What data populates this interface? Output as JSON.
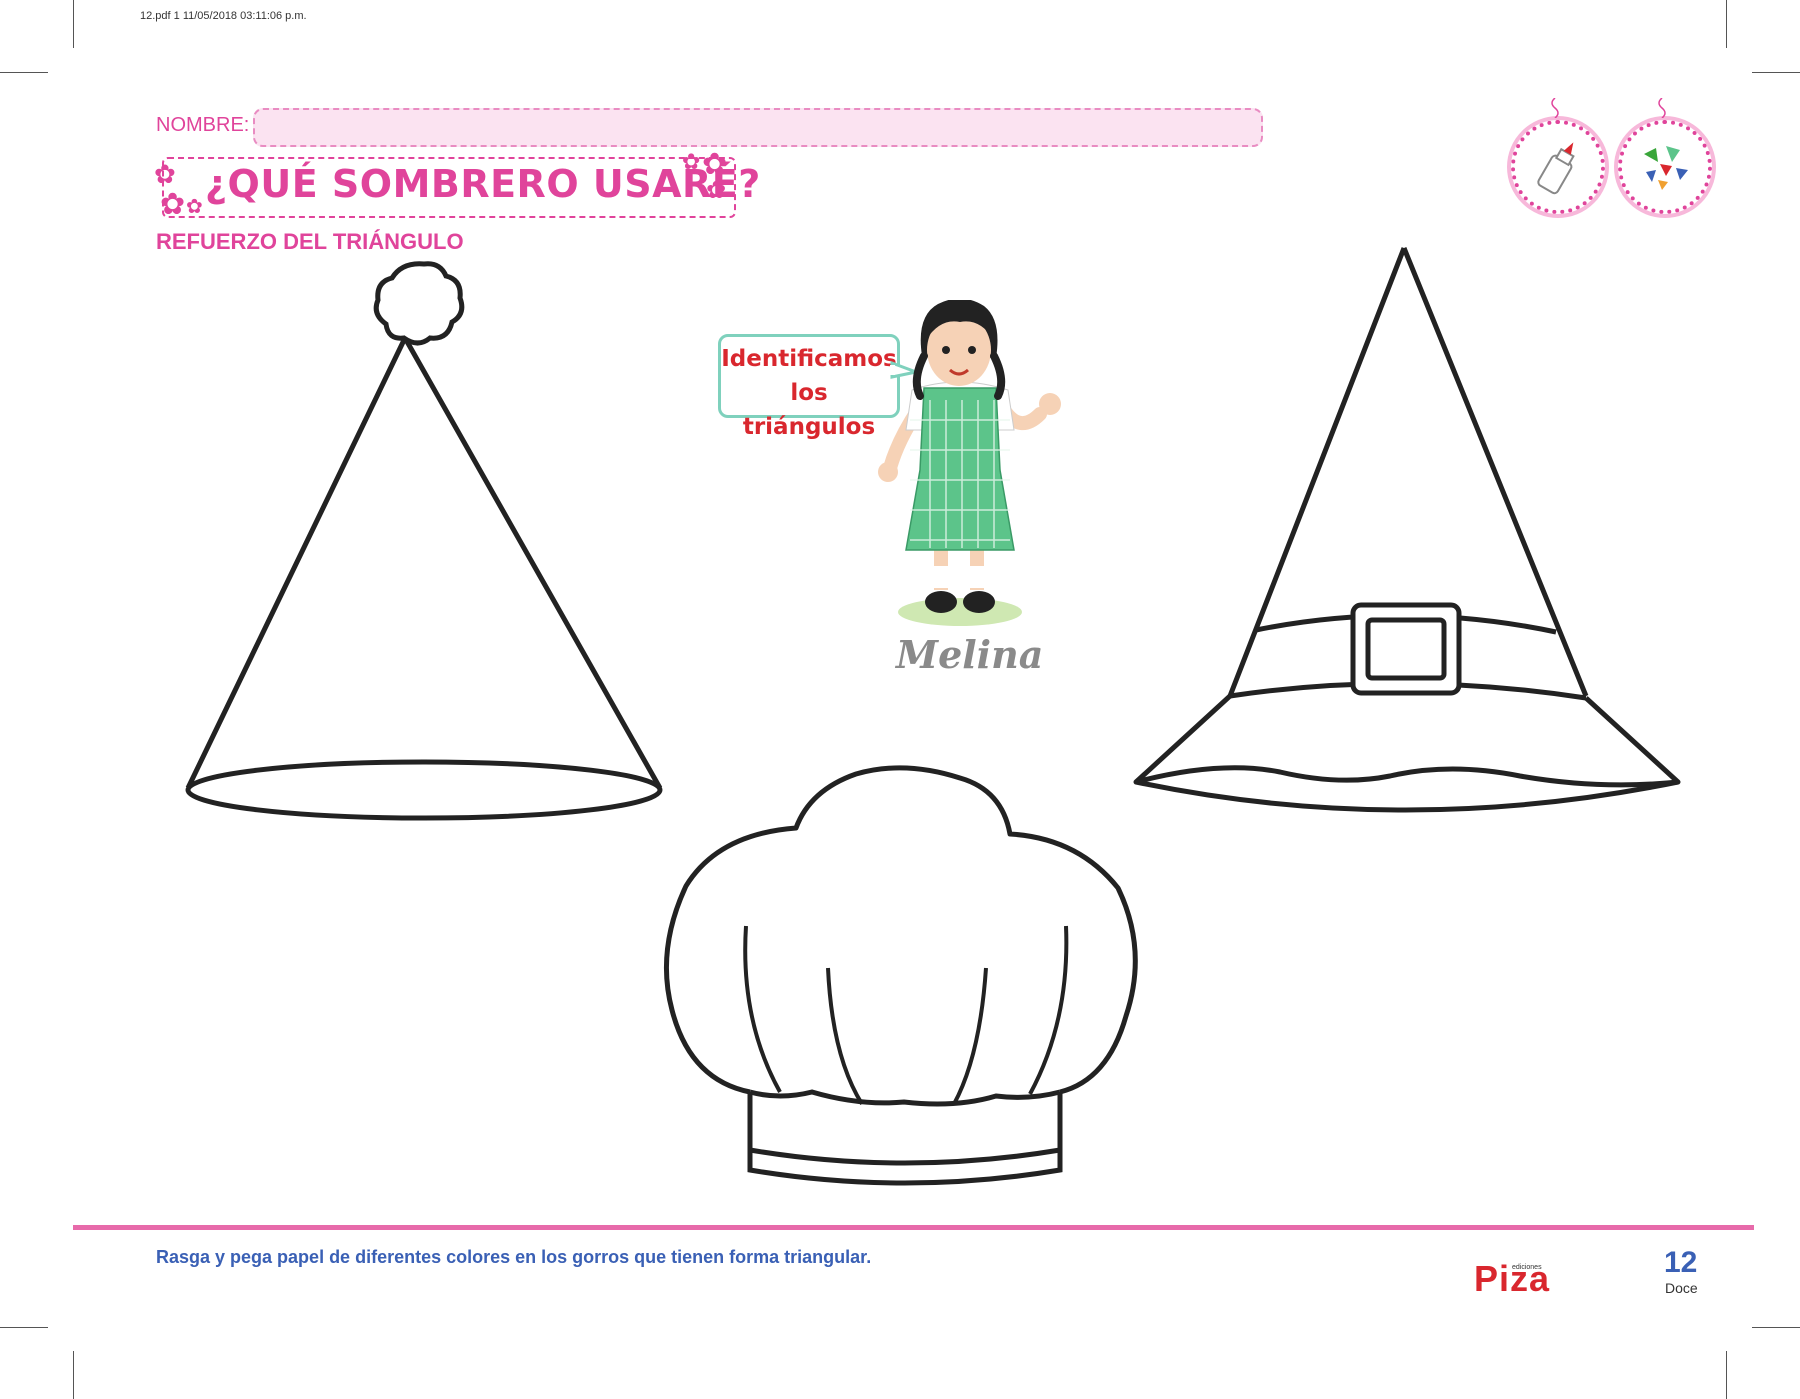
{
  "slug": "12.pdf   1   11/05/2018   03:11:06 p.m.",
  "header": {
    "name_label": "NOMBRE:",
    "title": "¿QUÉ SOMBRERO USARÉ?",
    "subtitle": "REFUERZO DEL TRIÁNGULO"
  },
  "icons": {
    "glue": "glue-bottle-icon",
    "paper": "torn-paper-icon"
  },
  "character": {
    "speech": [
      "Identificamos",
      "los triángulos"
    ],
    "name": "Melina"
  },
  "footer": {
    "instruction": "Rasga y pega papel de diferentes colores en los gorros que tienen forma triangular.",
    "publisher_small": "ediciones",
    "publisher": "Piza",
    "page_number": "12",
    "page_word": "Doce"
  },
  "colors": {
    "accent_pink": "#e0449b",
    "blue_text": "#3a60b5",
    "red_text": "#d9272e",
    "bubble_border": "#7fd1bd",
    "dress_green": "#5cc48a"
  }
}
